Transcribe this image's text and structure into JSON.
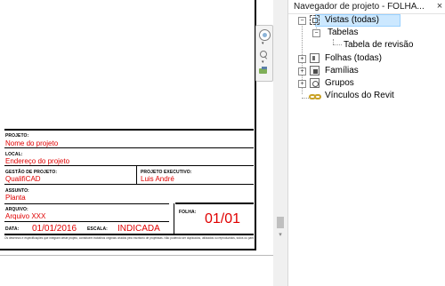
{
  "browser": {
    "title": "Navegador de projeto - FOLHA...",
    "close_label": "×",
    "tree": {
      "vistas": "Vistas (todas)",
      "tabelas": "Tabelas",
      "tabela_revisao": "Tabela de revisão",
      "folhas": "Folhas (todas)",
      "familias": "Famílias",
      "grupos": "Grupos",
      "vinculos": "Vínculos do Revit"
    },
    "toggles": {
      "expanded": "−",
      "collapsed": "+"
    }
  },
  "titleblock": {
    "projeto_label": "PROJETO:",
    "projeto_value": "Nome do projeto",
    "local_label": "LOCAL:",
    "local_value": "Endereço do projeto",
    "gestao_label": "GESTÃO DE PROJETO:",
    "gestao_value": "QualifiCAD",
    "executivo_label": "PROJETO EXECUTIVO:",
    "executivo_value": "Luis André",
    "assunto_label": "ASSUNTO:",
    "assunto_value": "Planta",
    "arquivo_label": "ARQUIVO:",
    "arquivo_value": "Arquivo XXX",
    "folha_label": "FOLHA:",
    "folha_value": "01/01",
    "data_label": "DATA:",
    "data_value": "01/01/2016",
    "escala_label": "ESCALA:",
    "escala_value": "INDICADA",
    "footnote": "Os desenhos e especificações que integram deste projeto, constituem trabalhos originais criados pelo escritório de projetistas. Não podendo ser duplicados, utilizados ou reproduzidos, todos ou parte deste, sem a autorização por escrito do escritório de projetistas."
  },
  "navbar": {
    "arrow": "▾"
  },
  "scrollbar": {
    "down_arrow": "▾"
  },
  "colors": {
    "value_red": "#e00000",
    "selection": "#cce8ff",
    "links_icon": "#c9a227"
  }
}
